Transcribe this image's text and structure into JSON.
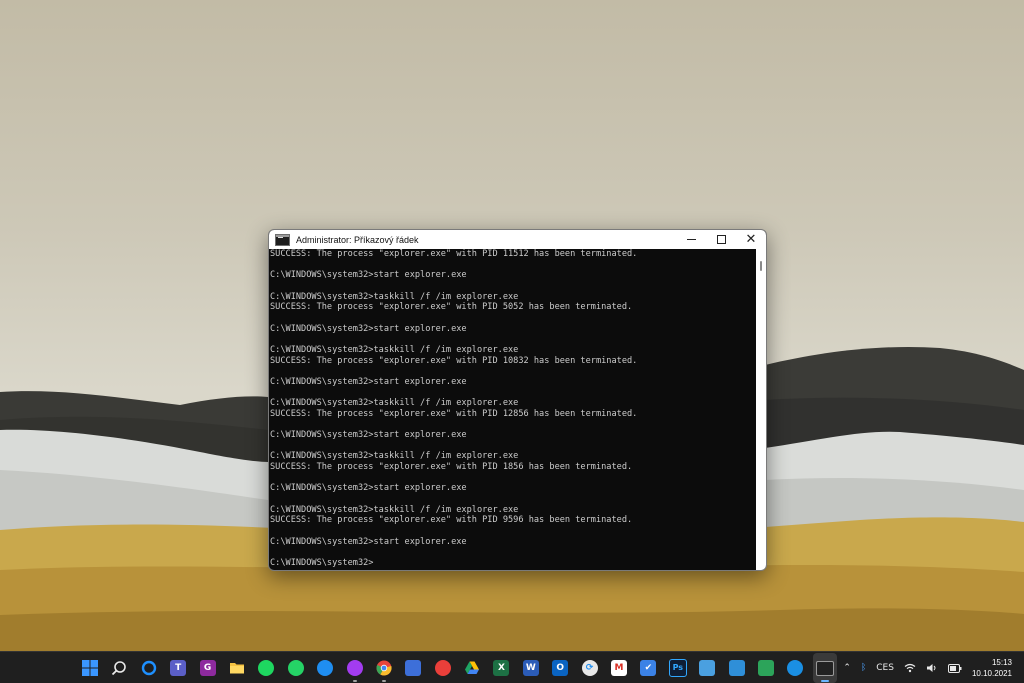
{
  "window": {
    "title": "Administrator: Příkazový řádek",
    "minimize_label": "Minimize",
    "maximize_label": "Maximize",
    "close_label": "Close",
    "close_glyph": "✕"
  },
  "console": {
    "lines": [
      "SUCCESS: The process \"explorer.exe\" with PID 11512 has been terminated.",
      "",
      "C:\\WINDOWS\\system32>start explorer.exe",
      "",
      "C:\\WINDOWS\\system32>taskkill /f /im explorer.exe",
      "SUCCESS: The process \"explorer.exe\" with PID 5052 has been terminated.",
      "",
      "C:\\WINDOWS\\system32>start explorer.exe",
      "",
      "C:\\WINDOWS\\system32>taskkill /f /im explorer.exe",
      "SUCCESS: The process \"explorer.exe\" with PID 10832 has been terminated.",
      "",
      "C:\\WINDOWS\\system32>start explorer.exe",
      "",
      "C:\\WINDOWS\\system32>taskkill /f /im explorer.exe",
      "SUCCESS: The process \"explorer.exe\" with PID 12856 has been terminated.",
      "",
      "C:\\WINDOWS\\system32>start explorer.exe",
      "",
      "C:\\WINDOWS\\system32>taskkill /f /im explorer.exe",
      "SUCCESS: The process \"explorer.exe\" with PID 1856 has been terminated.",
      "",
      "C:\\WINDOWS\\system32>start explorer.exe",
      "",
      "C:\\WINDOWS\\system32>taskkill /f /im explorer.exe",
      "SUCCESS: The process \"explorer.exe\" with PID 9596 has been terminated.",
      "",
      "C:\\WINDOWS\\system32>start explorer.exe",
      "",
      "C:\\WINDOWS\\system32>"
    ],
    "text_color": "#cccccc",
    "background_color": "#0c0c0c"
  },
  "taskbar": {
    "apps": [
      {
        "icon": "windows-start-icon",
        "glyph": "",
        "color": "#3a96ff",
        "running": false
      },
      {
        "icon": "search-icon",
        "glyph": "",
        "color": "",
        "running": false
      },
      {
        "icon": "cortana-icon",
        "glyph": "",
        "color": "#1e90ff",
        "running": false
      },
      {
        "icon": "teams-icon",
        "glyph": "T",
        "color": "#5b5fc7",
        "running": false
      },
      {
        "icon": "g-app-icon",
        "glyph": "G",
        "color": "#8e2a9e",
        "running": false
      },
      {
        "icon": "file-explorer-icon",
        "glyph": "",
        "color": "#f5c242",
        "running": false
      },
      {
        "icon": "spotify-icon",
        "glyph": "",
        "color": "#1ed760",
        "running": false
      },
      {
        "icon": "whatsapp-icon",
        "glyph": "",
        "color": "#25d366",
        "running": false
      },
      {
        "icon": "headphones-app-icon",
        "glyph": "",
        "color": "#1f8ef1",
        "running": false
      },
      {
        "icon": "messenger-icon",
        "glyph": "",
        "color": "#a33cf0",
        "running": true
      },
      {
        "icon": "chrome-icon",
        "glyph": "",
        "color": "#e8453c",
        "running": true
      },
      {
        "icon": "save-disk-icon",
        "glyph": "",
        "color": "#3d6fd9",
        "running": false
      },
      {
        "icon": "creative-cloud-icon",
        "glyph": "",
        "color": "#ea3f3a",
        "running": false
      },
      {
        "icon": "google-drive-icon",
        "glyph": "",
        "color": "#1fa463",
        "running": false
      },
      {
        "icon": "excel-icon",
        "glyph": "X",
        "color": "#1d7044",
        "running": false
      },
      {
        "icon": "word-icon",
        "glyph": "W",
        "color": "#2b5cb8",
        "running": false
      },
      {
        "icon": "outlook-icon",
        "glyph": "O",
        "color": "#0a64c2",
        "running": false
      },
      {
        "icon": "sync-icon",
        "glyph": "",
        "color": "#e8e8e8",
        "running": false
      },
      {
        "icon": "gmail-icon",
        "glyph": "M",
        "color": "#d93025",
        "running": false
      },
      {
        "icon": "todo-icon",
        "glyph": "✔",
        "color": "#3b82e6",
        "running": false
      },
      {
        "icon": "photoshop-icon",
        "glyph": "Ps",
        "color": "#0f1e34",
        "running": false
      },
      {
        "icon": "image-viewer-icon",
        "glyph": "",
        "color": "#4aa0e0",
        "running": false
      },
      {
        "icon": "photos-icon",
        "glyph": "",
        "color": "#2f8fd8",
        "running": false
      },
      {
        "icon": "green-diamond-app-icon",
        "glyph": "",
        "color": "#2ca45a",
        "running": false
      },
      {
        "icon": "network-app-icon",
        "glyph": "",
        "color": "#1a8fe3",
        "running": false
      },
      {
        "icon": "command-prompt-icon",
        "glyph": "",
        "color": "#222222",
        "running": true,
        "active": true
      }
    ]
  },
  "tray": {
    "chevron_glyph": "⌃",
    "bluetooth_glyph": "ᛒ",
    "language": "CES",
    "time": "15:13",
    "date": "10.10.2021"
  }
}
